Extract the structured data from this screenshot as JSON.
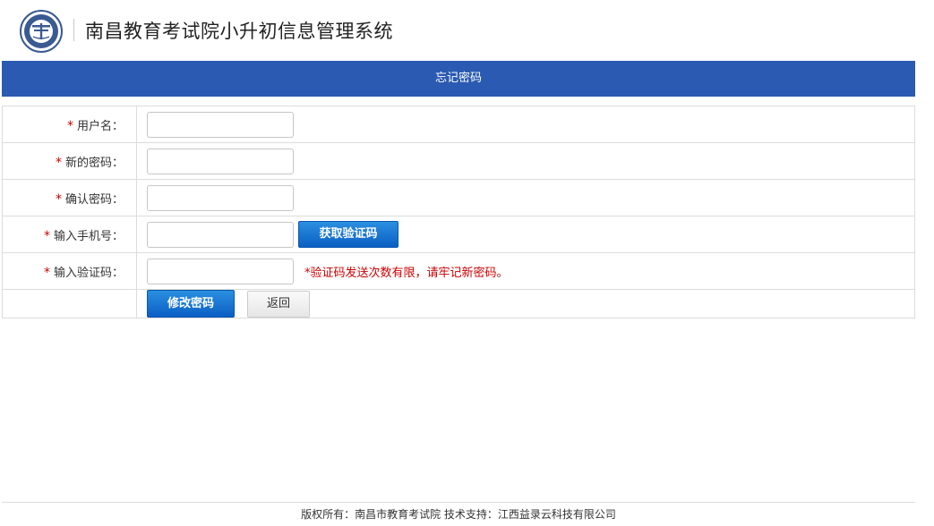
{
  "header": {
    "logo_icon": "school-emblem-icon",
    "title": "南昌教育考试院小升初信息管理系统"
  },
  "banner": {
    "title": "忘记密码"
  },
  "form": {
    "required_mark": "*",
    "username_label": "用户名：",
    "new_password_label": "新的密码：",
    "confirm_password_label": "确认密码：",
    "phone_label": "输入手机号：",
    "code_label": "输入验证码：",
    "get_code_button": "获取验证码",
    "code_hint": "*验证码发送次数有限，请牢记新密码。",
    "submit_button": "修改密码",
    "back_button": "返回"
  },
  "footer": {
    "text": "版权所有：南昌市教育考试院  技术支持：江西益录云科技有限公司"
  },
  "colors": {
    "banner": "#2a5ab1",
    "primary_button": "#0b5fc4",
    "hint_text": "#cc0000"
  }
}
